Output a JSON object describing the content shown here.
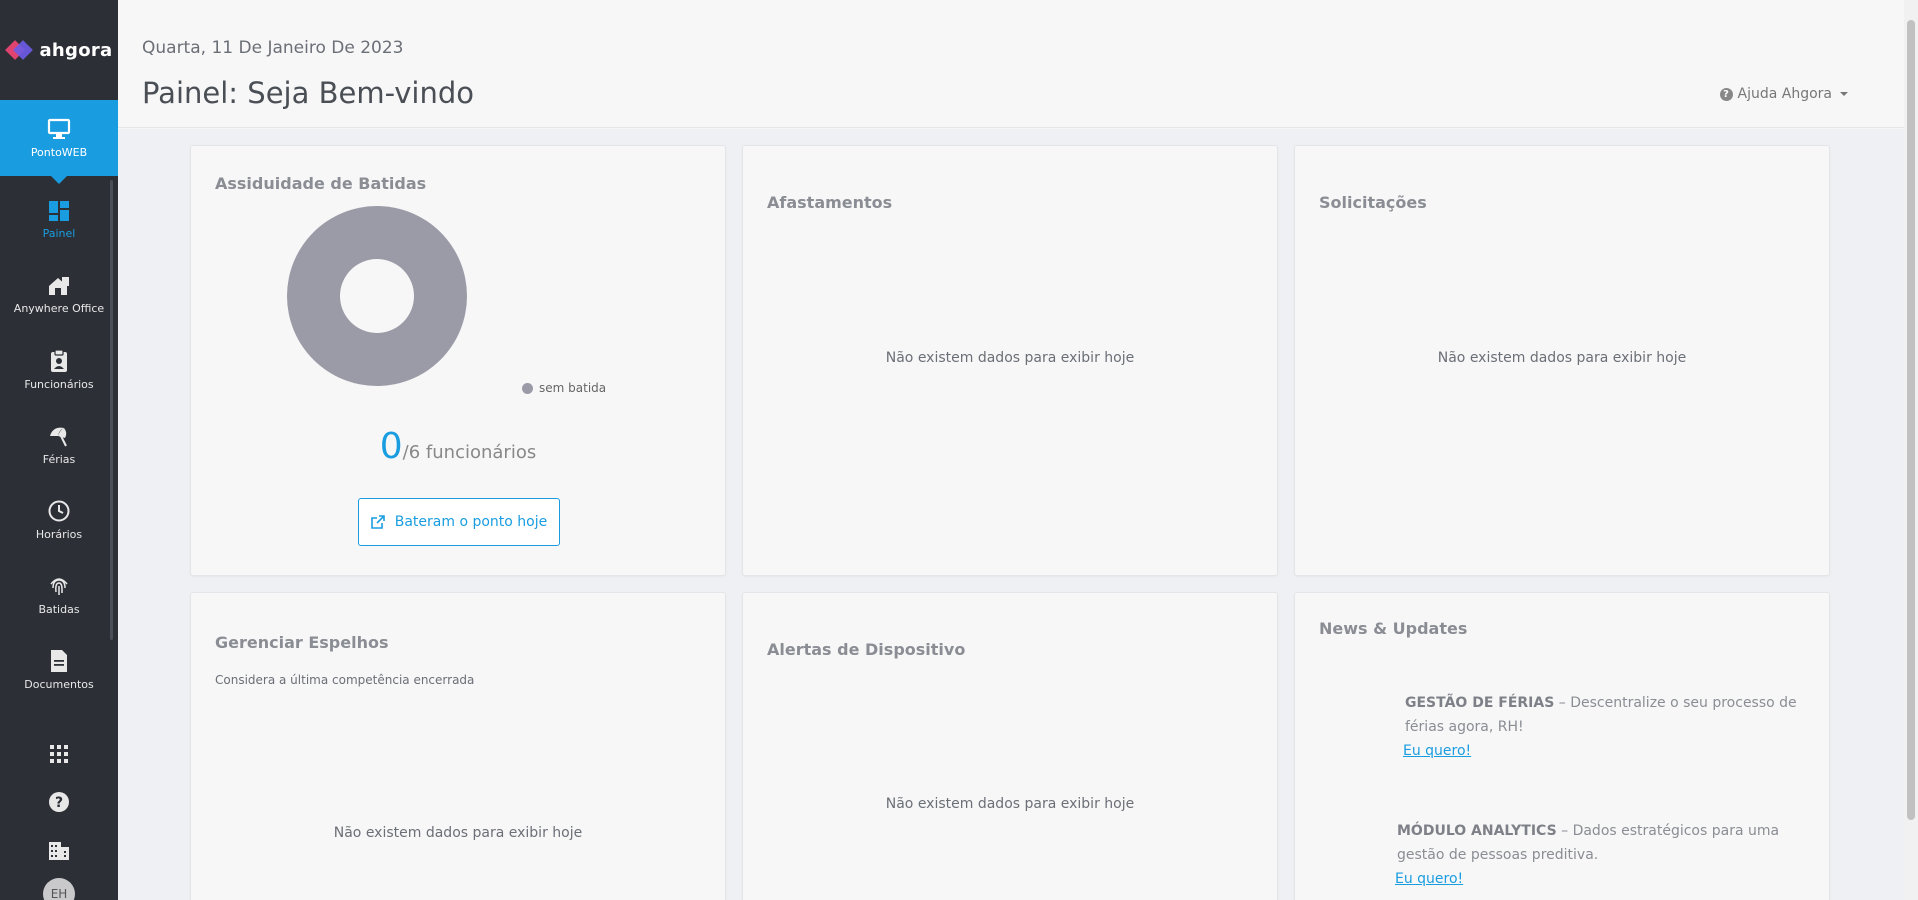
{
  "app": {
    "logo_text": "ahgora"
  },
  "sidebar": {
    "top": {
      "label": "PontoWEB",
      "icon": "monitor-icon"
    },
    "items": [
      {
        "label": "Painel",
        "icon": "dashboard-icon",
        "active": true
      },
      {
        "label": "Anywhere Office",
        "icon": "house-icon"
      },
      {
        "label": "Funcionários",
        "icon": "clipboard-icon"
      },
      {
        "label": "Férias",
        "icon": "beach-umbrella-icon"
      },
      {
        "label": "Horários",
        "icon": "clock-icon"
      },
      {
        "label": "Batidas",
        "icon": "fingerprint-icon"
      },
      {
        "label": "Documentos",
        "icon": "document-icon"
      }
    ],
    "bottom_icons": [
      "apps-grid-icon",
      "help-circle-icon",
      "building-icon"
    ],
    "avatar_initials": "EH"
  },
  "header": {
    "date": "Quarta, 11 De Janeiro De 2023",
    "title": "Painel: Seja Bem-vindo",
    "help_label": "Ajuda Ahgora"
  },
  "cards": {
    "assiduidade": {
      "title": "Assiduidade de Batidas",
      "legend_label": "sem batida",
      "count_value": "0",
      "count_total": "/6 funcionários",
      "button_label": "Bateram o ponto hoje"
    },
    "afastamentos": {
      "title": "Afastamentos",
      "empty": "Não existem dados para exibir hoje"
    },
    "solicitacoes": {
      "title": "Solicitações",
      "empty": "Não existem dados para exibir hoje"
    },
    "espelhos": {
      "title": "Gerenciar Espelhos",
      "subtitle": "Considera a última competência encerrada",
      "empty": "Não existem dados para exibir hoje"
    },
    "alertas": {
      "title": "Alertas de Dispositivo",
      "empty": "Não existem dados para exibir hoje"
    },
    "news": {
      "title": "News & Updates",
      "items": [
        {
          "heading": "GESTÃO DE FÉRIAS",
          "text": " – Descentralize o seu processo de férias agora, RH!",
          "link": "Eu quero!"
        },
        {
          "heading": "MÓDULO ANALYTICS",
          "text": " – Dados estratégicos para uma gestão de pessoas preditiva.",
          "link": "Eu quero!"
        }
      ]
    }
  },
  "colors": {
    "accent": "#1a9de0",
    "sidebar": "#2c2f36",
    "donut": "#9b9ba8"
  },
  "chart_data": {
    "type": "pie",
    "categories": [
      "sem batida"
    ],
    "values": [
      6
    ],
    "colors": [
      "#9b9ba8"
    ],
    "donut": true,
    "legend": "bottom-right"
  }
}
